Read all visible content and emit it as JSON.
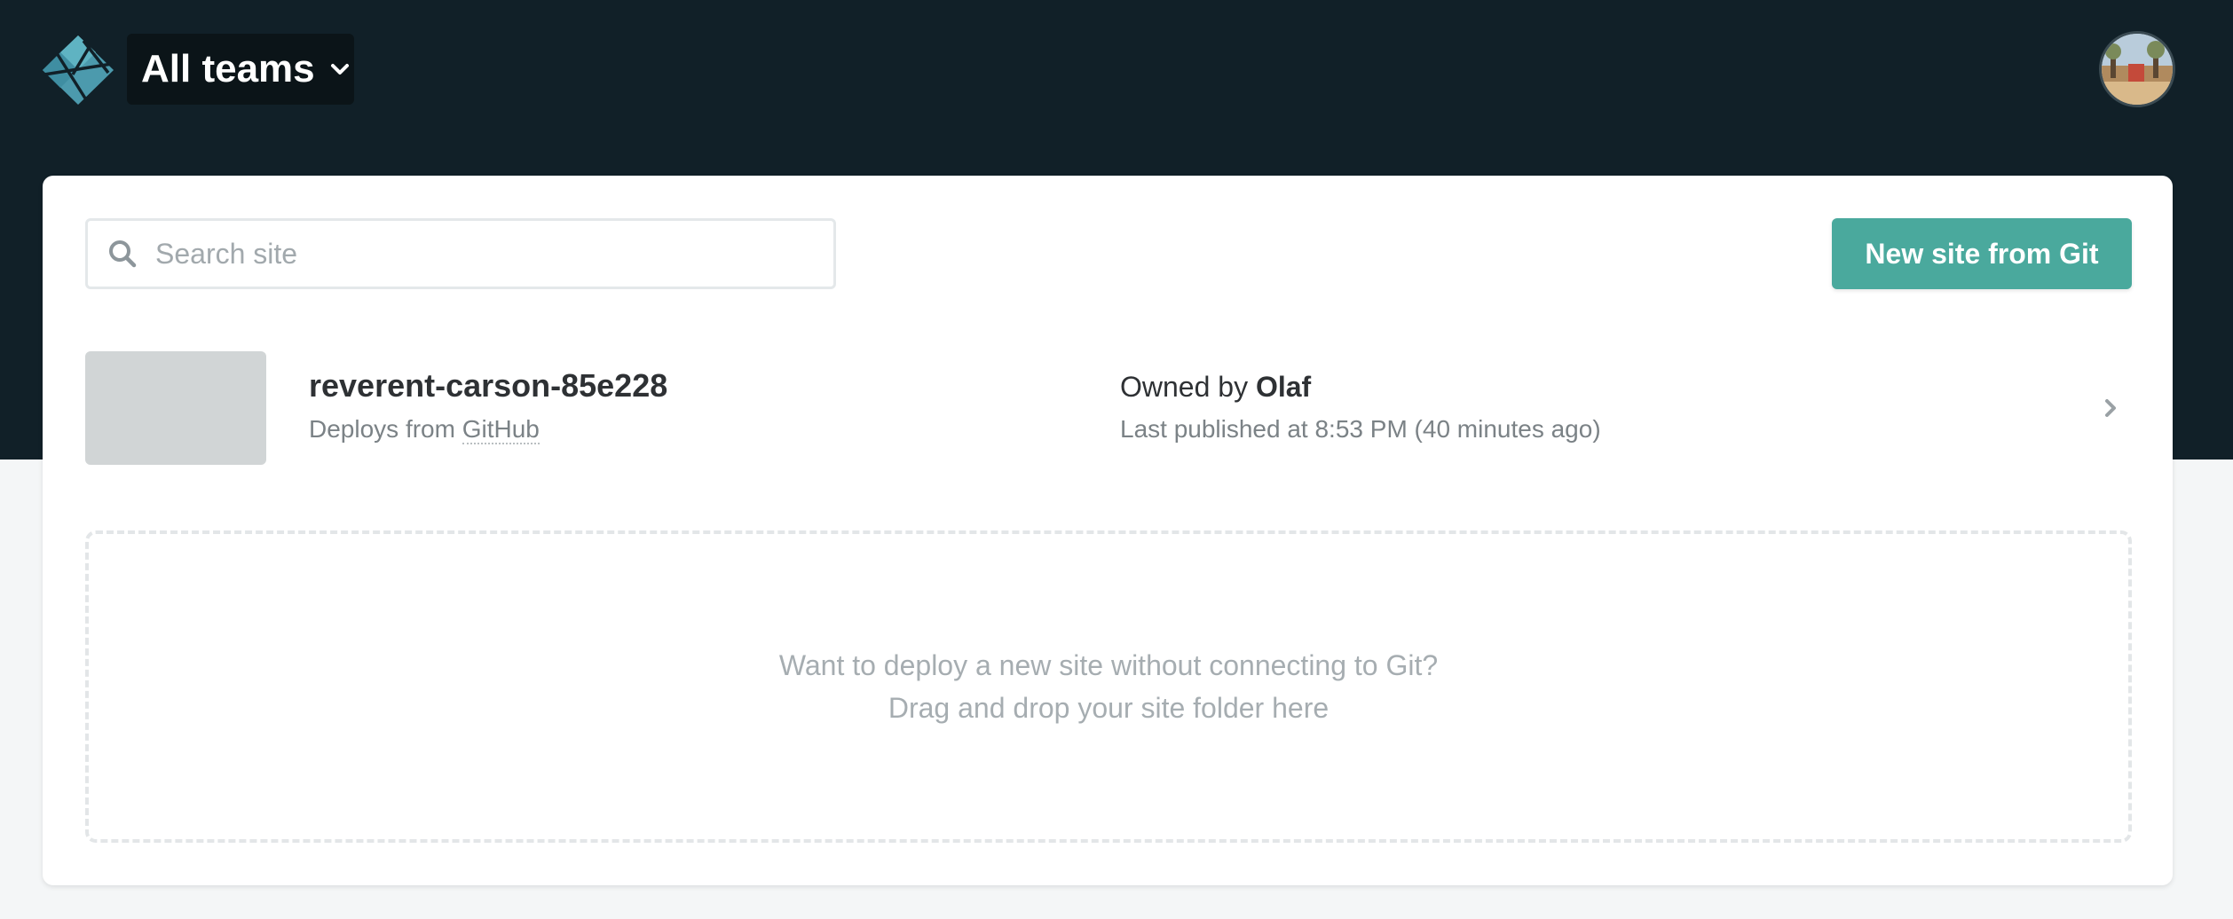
{
  "header": {
    "logo_icon": "netlify-logo-icon",
    "team_label": "All teams",
    "team_chevron_icon": "chevron-down-icon",
    "avatar_icon": "user-avatar"
  },
  "toolbar": {
    "search_icon": "search-icon",
    "search_placeholder": "Search site",
    "search_value": "",
    "new_site_label": "New site from Git"
  },
  "sites": [
    {
      "name": "reverent-carson-85e228",
      "deploys_prefix": "Deploys from",
      "deploys_source": "GitHub",
      "owned_prefix": "Owned by",
      "owner": "Olaf",
      "published": "Last published at 8:53 PM (40 minutes ago)",
      "chevron_icon": "chevron-right-icon"
    }
  ],
  "dropzone": {
    "line1": "Want to deploy a new site without connecting to Git?",
    "line2": "Drag and drop your site folder here"
  },
  "colors": {
    "header_bg": "#112028",
    "accent": "#4aa99d",
    "page_bg": "#f4f6f7"
  }
}
